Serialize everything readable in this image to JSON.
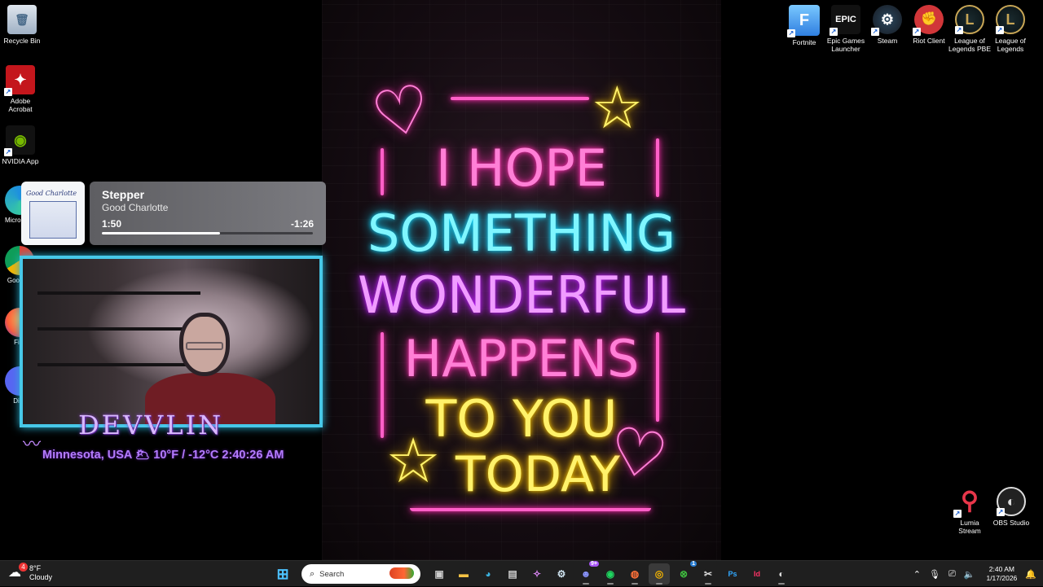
{
  "desktop_icons_left": [
    {
      "label": "Recycle Bin",
      "icon": "recycle-bin-icon"
    },
    {
      "label": "Adobe Acrobat",
      "icon": "acrobat-icon"
    },
    {
      "label": "NVIDIA App",
      "icon": "nvidia-icon"
    }
  ],
  "hidden_icons_left": [
    {
      "label": "Micro Edg",
      "icon": "edge-icon"
    },
    {
      "label": "Goo Chr",
      "icon": "chrome-icon"
    },
    {
      "label": "Fire",
      "icon": "firefox-icon"
    },
    {
      "label": "Disc",
      "icon": "discord-icon"
    }
  ],
  "desktop_icons_right": [
    {
      "label": "Fortnite",
      "icon": "fortnite-icon",
      "glyph": "F"
    },
    {
      "label": "Epic Games Launcher",
      "icon": "epic-games-icon",
      "glyph": "EPIC"
    },
    {
      "label": "Steam",
      "icon": "steam-icon",
      "glyph": "⚙"
    },
    {
      "label": "Riot Client",
      "icon": "riot-client-icon",
      "glyph": "✊"
    },
    {
      "label": "League of Legends PBE",
      "icon": "league-pbe-icon",
      "glyph": "L"
    },
    {
      "label": "League of Legends",
      "icon": "league-icon",
      "glyph": "L"
    }
  ],
  "desktop_icons_bottom_right": [
    {
      "label": "Lumia Stream",
      "icon": "lumia-stream-icon"
    },
    {
      "label": "OBS Studio",
      "icon": "obs-studio-icon"
    }
  ],
  "wallpaper": {
    "line1": "I HOPE",
    "line2": "SOMETHING",
    "line3": "WONDERFUL",
    "line4": "HAPPENS",
    "line5": "TO YOU",
    "line6": "TODAY"
  },
  "media": {
    "album_text": "Good Charlotte",
    "track": "Stepper",
    "artist": "Good Charlotte",
    "elapsed": "1:50",
    "remaining": "-1:26",
    "progress": 0.56
  },
  "overlay": {
    "name": "DEVVLIN",
    "weather_line": "Minnesota, USA 🌥 10°F / -12°C  2:40:26 AM"
  },
  "taskbar": {
    "weather_temp": "8°F",
    "weather_desc": "Cloudy",
    "weather_badge": "4",
    "search_placeholder": "Search",
    "discord_badge": "9+",
    "xbox_badge": "1",
    "time": "2:40 AM",
    "date": "1/17/2026"
  },
  "colors": {
    "accent_cyan": "#47c8e8",
    "overlay_purple": "#b47cff",
    "taskbar_bg": "#1f1f1f"
  }
}
